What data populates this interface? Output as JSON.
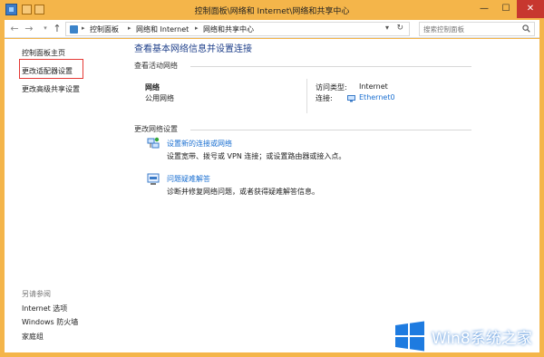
{
  "window": {
    "title": "控制面板\\网络和 Internet\\网络和共享中心",
    "minimize": "—",
    "maximize": "☐",
    "close": "✕"
  },
  "nav": {
    "back": "←",
    "forward": "→",
    "up": "↑",
    "breadcrumbs": [
      "控制面板",
      "网络和 Internet",
      "网络和共享中心"
    ],
    "separator": "▸",
    "dropdown": "▾",
    "refresh": "↻",
    "search_placeholder": "搜索控制面板"
  },
  "sidebar": {
    "items": [
      {
        "label": "控制面板主页"
      },
      {
        "label": "更改适配器设置"
      },
      {
        "label": "更改高级共享设置"
      }
    ],
    "see_also": {
      "heading": "另请参阅",
      "items": [
        {
          "label": "Internet 选项"
        },
        {
          "label": "Windows 防火墙"
        },
        {
          "label": "家庭组"
        }
      ]
    }
  },
  "main": {
    "title": "查看基本网络信息并设置连接",
    "active_section": "查看活动网络",
    "network": {
      "name": "网络",
      "type": "公用网络",
      "access_label": "访问类型:",
      "access_value": "Internet",
      "connection_label": "连接:",
      "connection_value": "Ethernet0"
    },
    "change_section": "更改网络设置",
    "tasks": [
      {
        "icon": "network-setup-icon",
        "link": "设置新的连接或网络",
        "desc": "设置宽带、拨号或 VPN 连接；或设置路由器或接入点。"
      },
      {
        "icon": "troubleshoot-icon",
        "link": "问题疑难解答",
        "desc": "诊断并修复网络问题，或者获得疑难解答信息。"
      }
    ]
  },
  "watermark": {
    "text": "Win8系统之家"
  },
  "colors": {
    "frame": "#f4b54a",
    "link": "#1a6fd1",
    "title": "#1e3f8a",
    "highlight": "#e53935"
  }
}
